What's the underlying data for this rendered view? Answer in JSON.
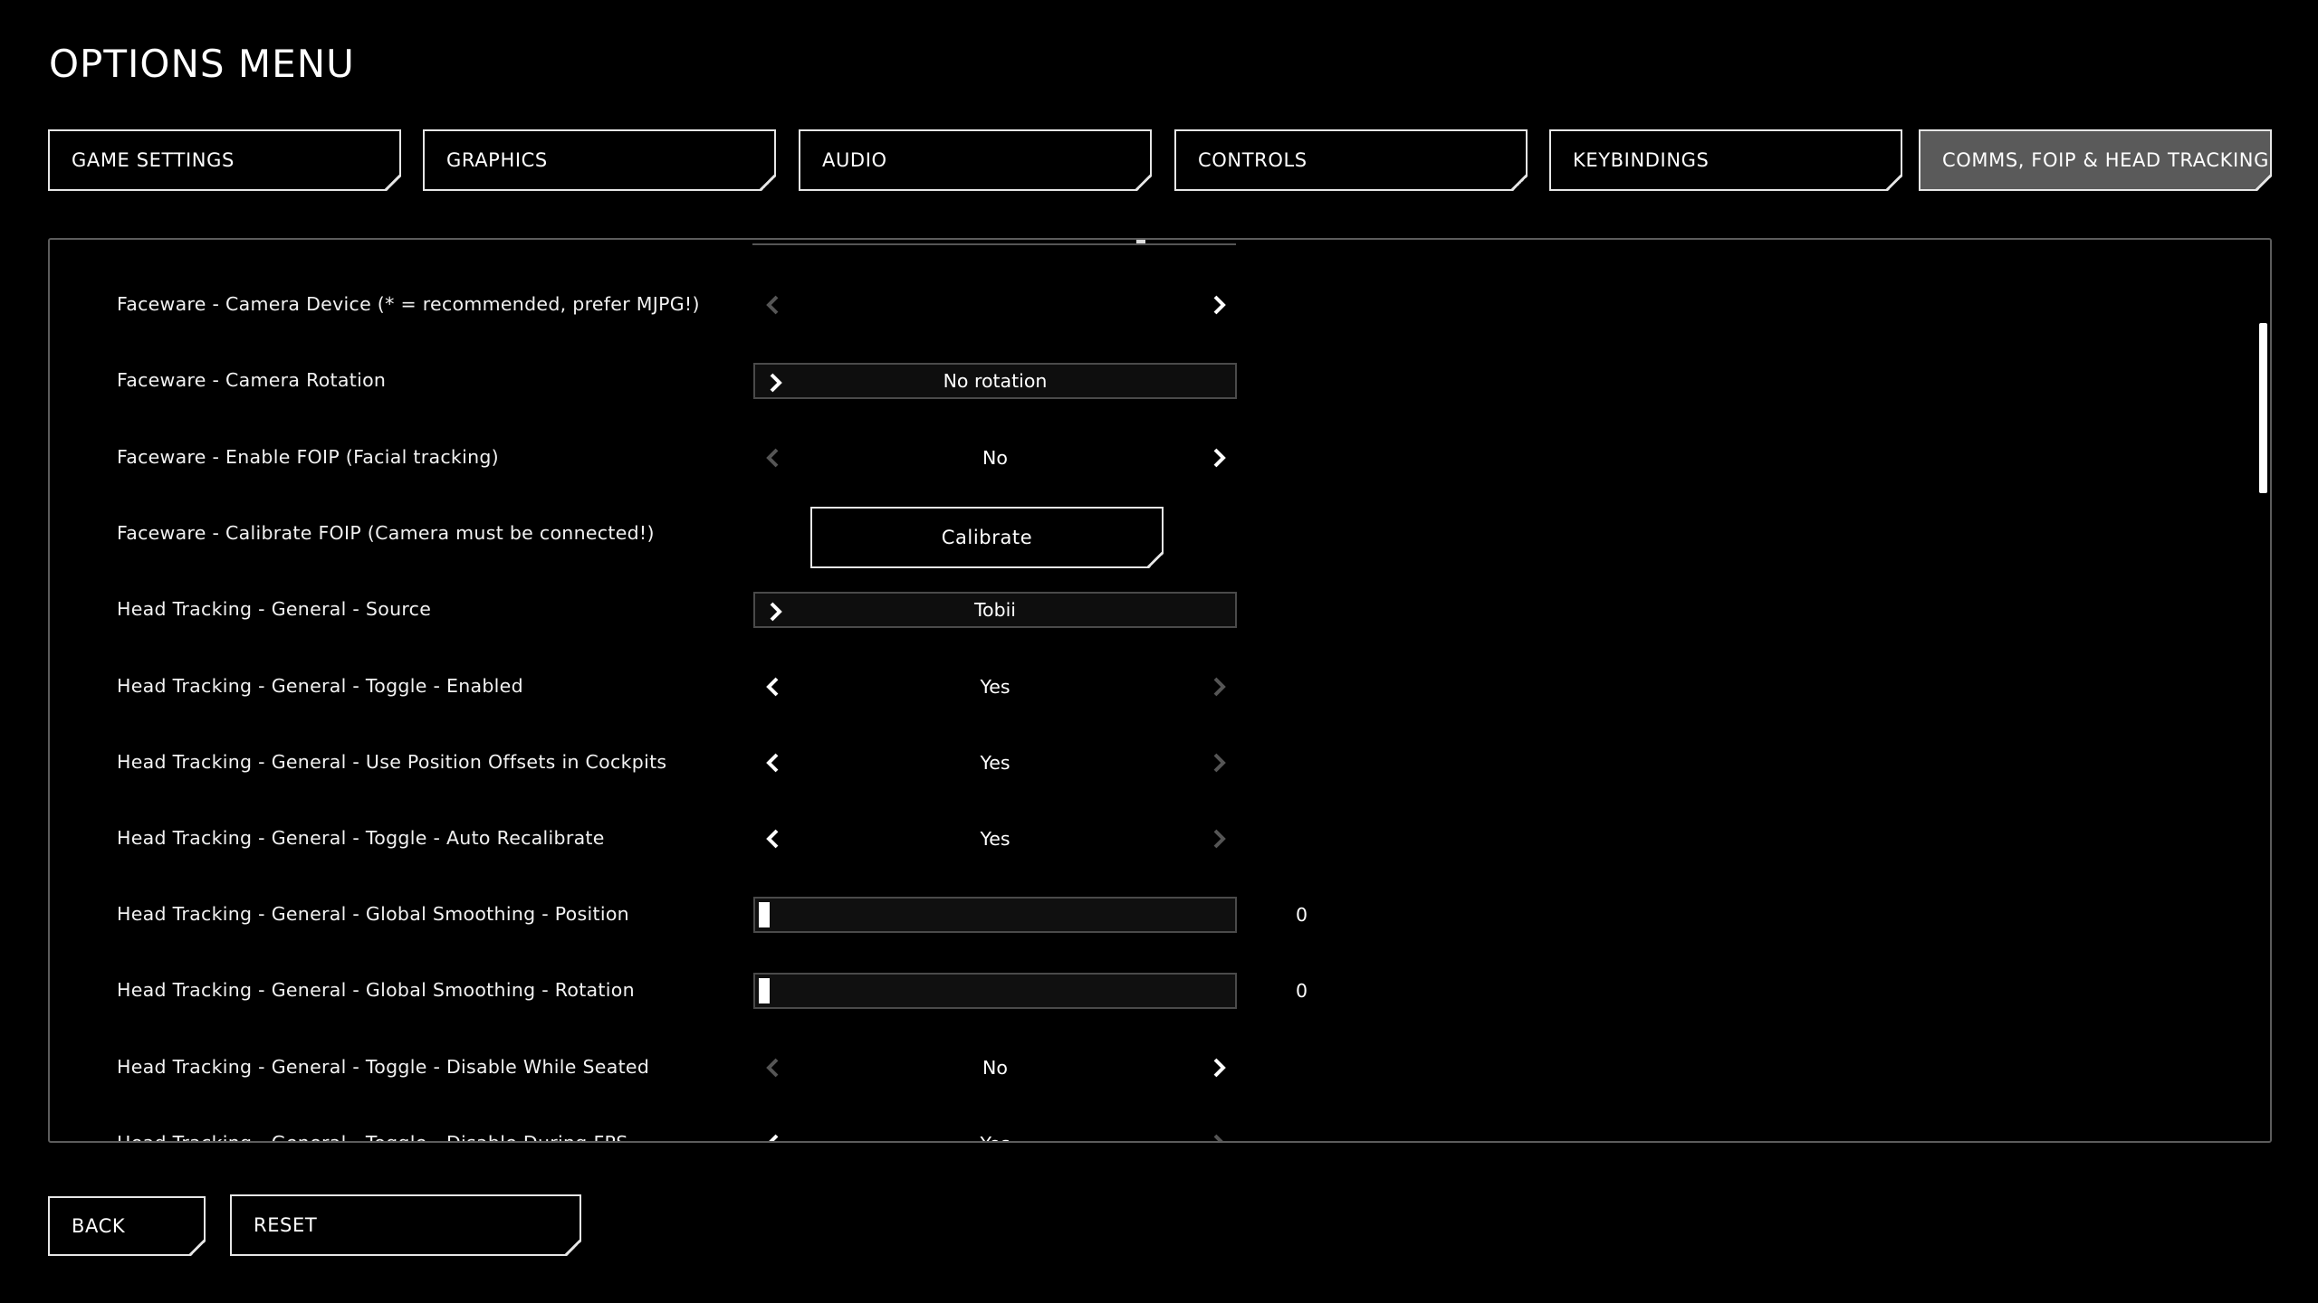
{
  "page": {
    "title": "OPTIONS MENU"
  },
  "tabs": [
    {
      "label": "GAME SETTINGS",
      "active": false
    },
    {
      "label": "GRAPHICS",
      "active": false
    },
    {
      "label": "AUDIO",
      "active": false
    },
    {
      "label": "CONTROLS",
      "active": false
    },
    {
      "label": "KEYBINDINGS",
      "active": false
    },
    {
      "label": "COMMS, FOIP & HEAD TRACKING",
      "active": true
    }
  ],
  "settings": [
    {
      "label": "Faceware - Camera Device (* = recommended, prefer MJPG!)",
      "type": "selector",
      "value": ""
    },
    {
      "label": "Faceware - Camera Rotation",
      "type": "dropdown",
      "value": "No rotation"
    },
    {
      "label": "Faceware - Enable FOIP (Facial tracking)",
      "type": "selector",
      "value": "No"
    },
    {
      "label": "Faceware - Calibrate FOIP (Camera must be connected!)",
      "type": "button",
      "value": "Calibrate"
    },
    {
      "label": "Head Tracking - General - Source",
      "type": "dropdown",
      "value": "Tobii"
    },
    {
      "label": "Head Tracking - General - Toggle - Enabled",
      "type": "selector",
      "value": "Yes"
    },
    {
      "label": "Head Tracking - General - Use Position Offsets in Cockpits",
      "type": "selector",
      "value": "Yes"
    },
    {
      "label": "Head Tracking - General - Toggle - Auto Recalibrate",
      "type": "selector",
      "value": "Yes"
    },
    {
      "label": "Head Tracking - General - Global Smoothing - Position",
      "type": "slider",
      "value": "0",
      "fill": 0
    },
    {
      "label": "Head Tracking - General - Global Smoothing - Rotation",
      "type": "slider",
      "value": "0",
      "fill": 0
    },
    {
      "label": "Head Tracking - General - Toggle - Disable While Seated",
      "type": "selector",
      "value": "No"
    },
    {
      "label": "Head Tracking - General - Toggle - Disable During FPS",
      "type": "selector",
      "value": "Yes"
    }
  ],
  "footer": {
    "back_label": "BACK",
    "reset_label": "RESET"
  },
  "colors": {
    "background": "#000000",
    "border": "#e6e6e6",
    "active_tab": "#5a5a5a",
    "dim_arrow": "#555555"
  }
}
